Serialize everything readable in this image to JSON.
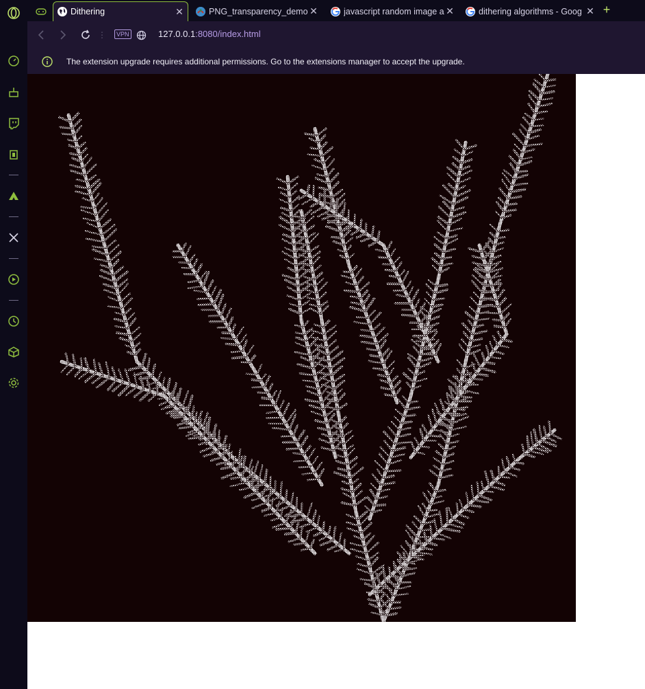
{
  "sidebar": {
    "items": [
      {
        "icon": "opera-logo-icon"
      },
      {
        "icon": "speed-dial-icon"
      },
      {
        "icon": "cleaner-icon"
      },
      {
        "icon": "twitch-icon"
      },
      {
        "icon": "gx-control-icon"
      },
      {
        "icon": "aria-icon"
      },
      {
        "icon": "x-icon"
      },
      {
        "icon": "player-icon"
      },
      {
        "icon": "history-icon"
      },
      {
        "icon": "extensions-icon"
      },
      {
        "icon": "settings-icon"
      }
    ]
  },
  "tabs": [
    {
      "title": "",
      "icon": "gamepad-icon"
    },
    {
      "title": "Dithering",
      "icon": "globe-icon",
      "active": true
    },
    {
      "title": "PNG_transparency_demonst",
      "icon": "wikimedia-icon"
    },
    {
      "title": "javascript random image ap",
      "icon": "google-icon"
    },
    {
      "title": "dithering algorithms - Goog",
      "icon": "google-icon"
    }
  ],
  "new_tab_symbol": "+",
  "toolbar": {
    "vpn_label": "VPN",
    "url_host": "127.0.0.1",
    "url_rest": ":8080/index.html"
  },
  "infobar": {
    "message": "The extension upgrade requires additional permissions. Go to the extensions manager to accept the upgrade."
  },
  "colors": {
    "accent": "#8fbe3e",
    "chrome_bg": "#1f1630",
    "sidebar_bg": "#0d0b1a",
    "image_bg": "#130304"
  },
  "image": {
    "description_label": "dithered plant image"
  }
}
